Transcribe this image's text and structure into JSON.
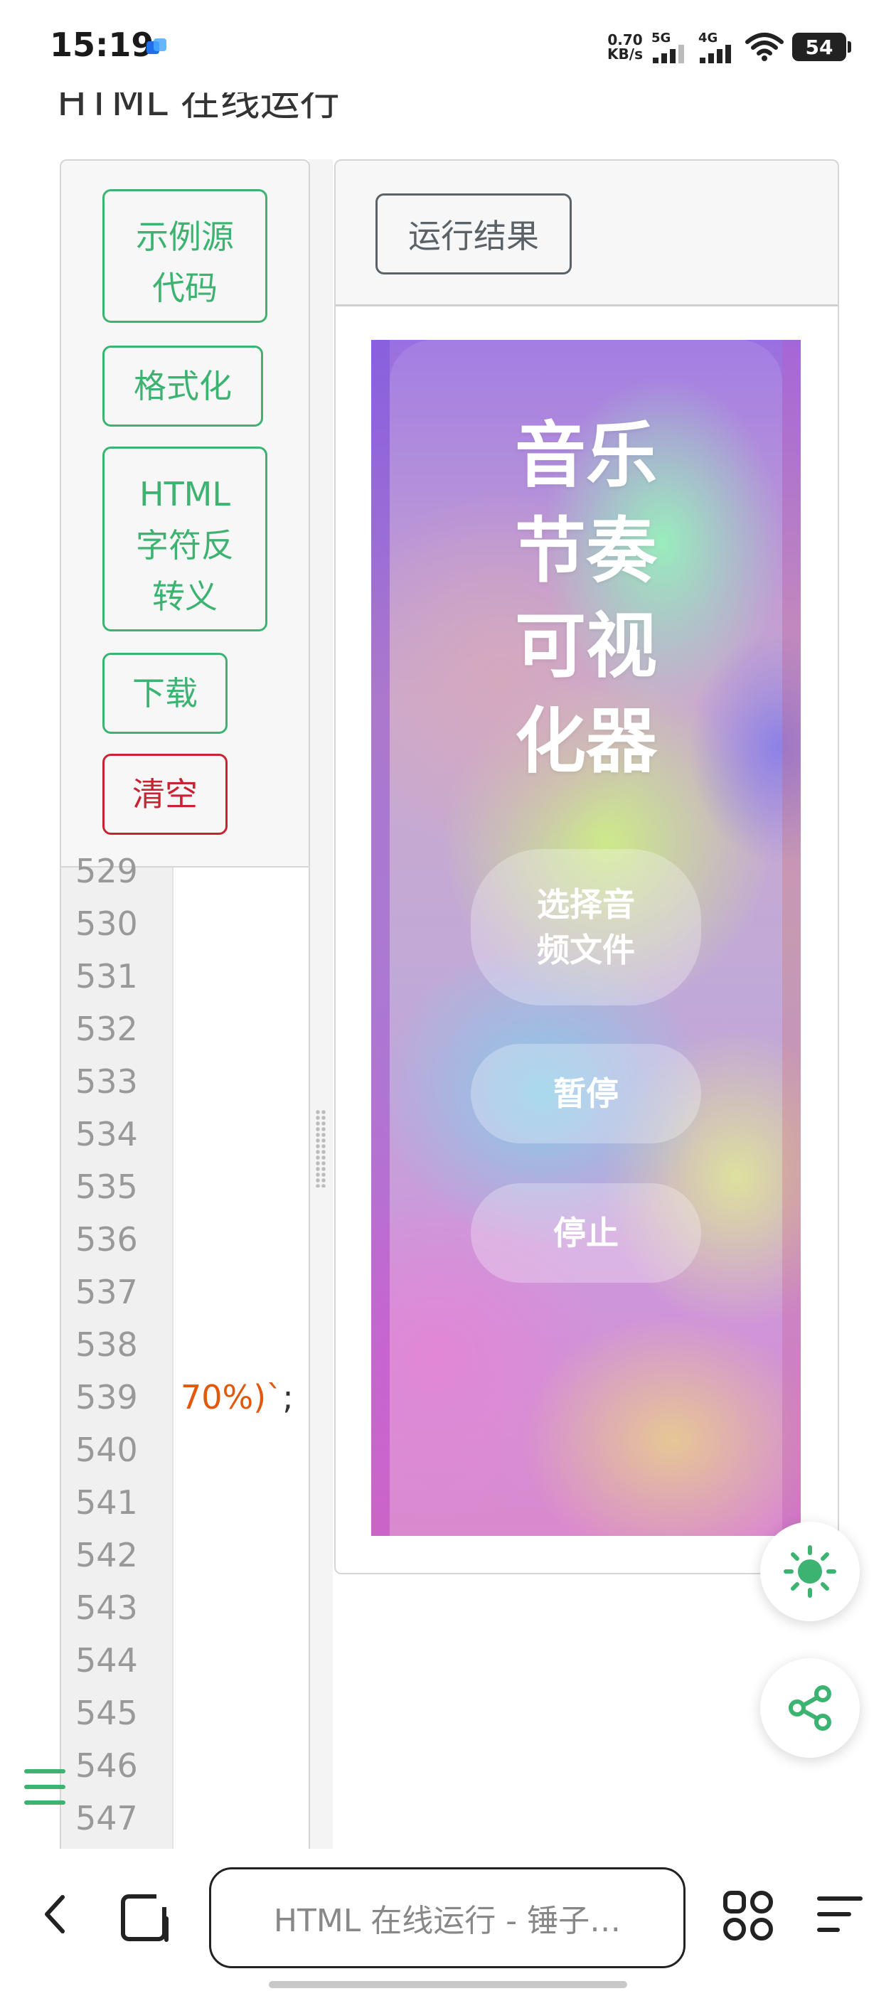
{
  "status_bar": {
    "time": "15:19",
    "net_speed_value": "0.70",
    "net_speed_unit": "KB/s",
    "signal_1": "5G",
    "signal_2": "4G",
    "battery": "54"
  },
  "page": {
    "heading": "HTML 在线运行"
  },
  "toolbar": {
    "buttons": [
      {
        "label": "示例源代码",
        "lines": [
          "示例源",
          "代码"
        ]
      },
      {
        "label": "格式化"
      },
      {
        "label": "HTML字符反转义",
        "lines": [
          "HTML",
          "字符反",
          "转义"
        ]
      },
      {
        "label": "下载"
      },
      {
        "label": "清空"
      }
    ]
  },
  "editor": {
    "line_numbers": [
      "529",
      "530",
      "531",
      "532",
      "533",
      "534",
      "535",
      "536",
      "537",
      "538",
      "539",
      "540",
      "541",
      "542",
      "543",
      "544",
      "545",
      "546",
      "547"
    ],
    "visible_code": {
      "line": "539",
      "text": "70%)`",
      "tail": ";"
    }
  },
  "result": {
    "tab_label": "运行结果",
    "preview": {
      "title_lines": [
        "音乐",
        "节奏",
        "可视",
        "化器"
      ],
      "buttons": {
        "select_file": [
          "选择音",
          "频文件"
        ],
        "pause": "暂停",
        "stop": "停止"
      }
    }
  },
  "fabs": {
    "theme": "sun-icon",
    "share": "share-icon"
  },
  "browser": {
    "address": "HTML 在线运行 - 锤子…",
    "colors": {
      "accent": "#3cb371",
      "danger": "#c82333",
      "secondary": "#5a6268"
    }
  }
}
